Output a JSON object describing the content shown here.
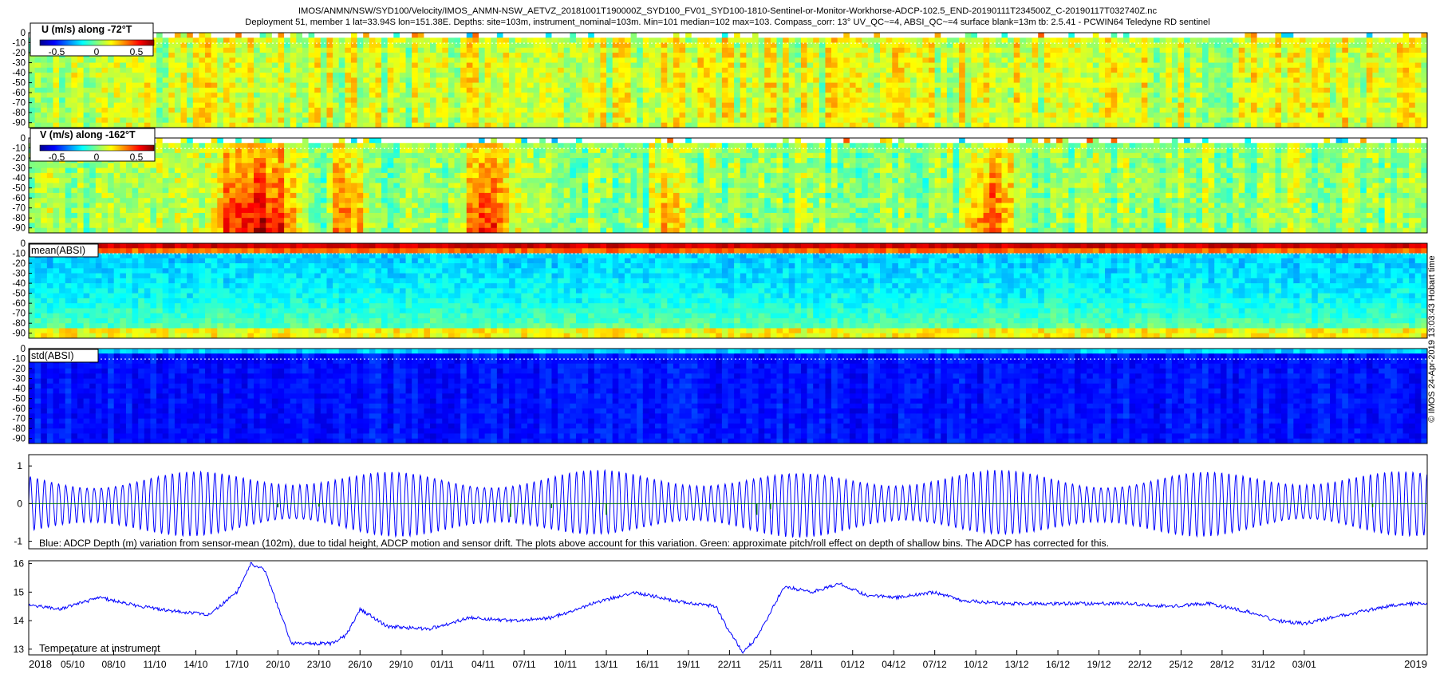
{
  "header": {
    "line1": "IMOS/ANMN/NSW/SYD100/Velocity/IMOS_ANMN-NSW_AETVZ_20181001T190000Z_SYD100_FV01_SYD100-1810-Sentinel-or-Monitor-Workhorse-ADCP-102.5_END-20190111T234500Z_C-20190117T032740Z.nc",
    "line2": "Deployment 51, member 1 lat=33.94S lon=151.38E. Depths: site=103m, instrument_nominal=103m. Min=101 median=102 max=103. Compass_corr: 13° UV_QC~=4, ABSI_QC~=4 surface blank=13m tb: 2.5.41 - PCWIN64 Teledyne RD sentinel"
  },
  "side_note": "© IMOS 24-Apr-2019 13:03:43 Hobart time",
  "colors": {
    "axis": "#000000",
    "series_depth": "#0000ff",
    "series_pitch": "#007a00",
    "series_temp": "#0000ff"
  },
  "chart_data": [
    {
      "type": "heatmap",
      "label": "U (m/s) along -72°T",
      "colormap": "jet",
      "colorbar_ticks": [
        "-0.5",
        "0",
        "0.5"
      ],
      "y_ticks": [
        "0",
        "-10",
        "-20",
        "-30",
        "-40",
        "-50",
        "-60",
        "-70",
        "-80",
        "-90"
      ],
      "ylim": [
        -95,
        0
      ],
      "value_range": [
        -0.7,
        0.7
      ]
    },
    {
      "type": "heatmap",
      "label": "V (m/s) along -162°T",
      "colormap": "jet",
      "colorbar_ticks": [
        "-0.5",
        "0",
        "0.5"
      ],
      "y_ticks": [
        "0",
        "-10",
        "-20",
        "-30",
        "-40",
        "-50",
        "-60",
        "-70",
        "-80",
        "-90"
      ],
      "ylim": [
        -95,
        0
      ],
      "value_range": [
        -0.7,
        0.7
      ]
    },
    {
      "type": "heatmap",
      "label": "mean(ABSI)",
      "colormap": "jet",
      "y_ticks": [
        "0",
        "-10",
        "-20",
        "-30",
        "-40",
        "-50",
        "-60",
        "-70",
        "-80",
        "-90"
      ],
      "ylim": [
        -95,
        0
      ]
    },
    {
      "type": "heatmap",
      "label": "std(ABSI)",
      "colormap": "jet",
      "y_ticks": [
        "0",
        "-10",
        "-20",
        "-30",
        "-40",
        "-50",
        "-60",
        "-70",
        "-80",
        "-90"
      ],
      "ylim": [
        -95,
        0
      ]
    },
    {
      "type": "line",
      "caption": "Blue: ADCP Depth (m) variation from sensor-mean (102m), due to tidal height, ADCP motion and sensor drift. The plots above account for this variation. Green: approximate pitch/roll effect on depth of shallow bins. The ADCP has corrected for this.",
      "y_ticks": [
        "1",
        "0",
        "-1"
      ],
      "ylim": [
        -1.2,
        1.3
      ],
      "series": [
        {
          "tidal_amplitude_range": [
            0.45,
            0.85
          ],
          "cycles_per_day": 1.93
        }
      ],
      "pitch_dips": [
        {
          "date": "2018-10-20",
          "depth": -0.1
        },
        {
          "date": "2018-10-23",
          "depth": -0.08
        },
        {
          "date": "2018-11-06",
          "depth": -0.35
        },
        {
          "date": "2018-11-09",
          "depth": -0.12
        },
        {
          "date": "2018-11-13",
          "depth": -0.3
        },
        {
          "date": "2018-11-24",
          "depth": -0.3
        },
        {
          "date": "2018-11-25",
          "depth": -0.15
        },
        {
          "date": "2019-01-08",
          "depth": -0.1
        }
      ]
    },
    {
      "type": "line",
      "label": "Temperature at instrument",
      "y_ticks": [
        "16",
        "15",
        "14",
        "13"
      ],
      "ylim": [
        12.8,
        16.1
      ],
      "x": [
        "2018-10-01",
        "2018-10-04",
        "2018-10-07",
        "2018-10-10",
        "2018-10-13",
        "2018-10-15",
        "2018-10-17",
        "2018-10-18",
        "2018-10-19",
        "2018-10-21",
        "2018-10-24",
        "2018-10-25",
        "2018-10-26",
        "2018-10-28",
        "2018-10-31",
        "2018-11-03",
        "2018-11-06",
        "2018-11-09",
        "2018-11-12",
        "2018-11-15",
        "2018-11-18",
        "2018-11-21",
        "2018-11-22",
        "2018-11-23",
        "2018-11-24",
        "2018-11-26",
        "2018-11-28",
        "2018-11-30",
        "2018-12-02",
        "2018-12-04",
        "2018-12-07",
        "2018-12-09",
        "2018-12-12",
        "2018-12-15",
        "2018-12-18",
        "2018-12-21",
        "2018-12-24",
        "2018-12-27",
        "2018-12-30",
        "2019-01-01",
        "2019-01-03",
        "2019-01-06",
        "2019-01-09",
        "2019-01-11"
      ],
      "values": [
        14.6,
        14.4,
        14.8,
        14.5,
        14.3,
        14.2,
        15.0,
        16.0,
        15.8,
        13.2,
        13.2,
        13.5,
        14.4,
        13.8,
        13.7,
        14.1,
        14.0,
        14.1,
        14.6,
        15.0,
        14.7,
        14.5,
        13.6,
        12.9,
        13.4,
        15.2,
        15.0,
        15.3,
        14.9,
        14.8,
        15.0,
        14.7,
        14.6,
        14.6,
        14.6,
        14.6,
        14.5,
        14.6,
        14.3,
        14.0,
        13.9,
        14.2,
        14.5,
        14.6
      ]
    }
  ],
  "x_axis": {
    "year_start": "2018",
    "year_end": "2019",
    "ticks": [
      {
        "label": "05/10",
        "date": "2018-10-05"
      },
      {
        "label": "08/10",
        "date": "2018-10-08"
      },
      {
        "label": "11/10",
        "date": "2018-10-11"
      },
      {
        "label": "14/10",
        "date": "2018-10-14"
      },
      {
        "label": "17/10",
        "date": "2018-10-17"
      },
      {
        "label": "20/10",
        "date": "2018-10-20"
      },
      {
        "label": "23/10",
        "date": "2018-10-23"
      },
      {
        "label": "26/10",
        "date": "2018-10-26"
      },
      {
        "label": "29/10",
        "date": "2018-10-29"
      },
      {
        "label": "01/11",
        "date": "2018-11-01"
      },
      {
        "label": "04/11",
        "date": "2018-11-04"
      },
      {
        "label": "07/11",
        "date": "2018-11-07"
      },
      {
        "label": "10/11",
        "date": "2018-11-10"
      },
      {
        "label": "13/11",
        "date": "2018-11-13"
      },
      {
        "label": "16/11",
        "date": "2018-11-16"
      },
      {
        "label": "19/11",
        "date": "2018-11-19"
      },
      {
        "label": "22/11",
        "date": "2018-11-22"
      },
      {
        "label": "25/11",
        "date": "2018-11-25"
      },
      {
        "label": "28/11",
        "date": "2018-11-28"
      },
      {
        "label": "01/12",
        "date": "2018-12-01"
      },
      {
        "label": "04/12",
        "date": "2018-12-04"
      },
      {
        "label": "07/12",
        "date": "2018-12-07"
      },
      {
        "label": "10/12",
        "date": "2018-12-10"
      },
      {
        "label": "13/12",
        "date": "2018-12-13"
      },
      {
        "label": "16/12",
        "date": "2018-12-16"
      },
      {
        "label": "19/12",
        "date": "2018-12-19"
      },
      {
        "label": "22/12",
        "date": "2018-12-22"
      },
      {
        "label": "25/12",
        "date": "2018-12-25"
      },
      {
        "label": "28/12",
        "date": "2018-12-28"
      },
      {
        "label": "31/12",
        "date": "2018-12-31"
      },
      {
        "label": "03/01",
        "date": "2019-01-03"
      }
    ],
    "range": [
      "2018-10-01T19:00",
      "2019-01-11T23:45"
    ]
  }
}
